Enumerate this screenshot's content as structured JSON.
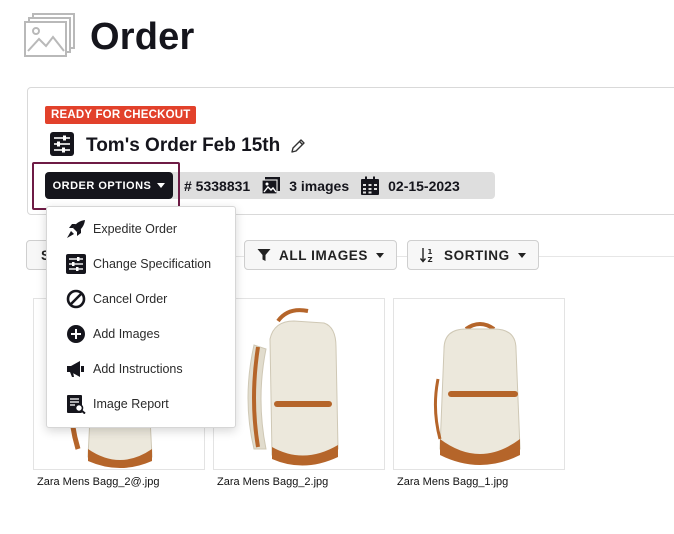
{
  "header": {
    "title": "Order",
    "icon": "image-gallery-icon"
  },
  "order": {
    "status": "READY FOR CHECKOUT",
    "status_color": "#e2412b",
    "title": "Tom's Order Feb 15th",
    "options_label": "ORDER OPTIONS",
    "number": "# 5338831",
    "image_count": "3 images",
    "date": "02-15-2023"
  },
  "toolbar": {
    "first_label": "S",
    "filter_label": "ALL IMAGES",
    "sort_label": "SORTING"
  },
  "menu": {
    "items": [
      {
        "label": "Expedite Order",
        "icon": "rocket-icon"
      },
      {
        "label": "Change Specification",
        "icon": "sliders-icon"
      },
      {
        "label": "Cancel Order",
        "icon": "cancel-icon"
      },
      {
        "label": "Add Images",
        "icon": "plus-circle-icon"
      },
      {
        "label": "Add Instructions",
        "icon": "megaphone-icon"
      },
      {
        "label": "Image Report",
        "icon": "report-icon"
      }
    ]
  },
  "products": [
    {
      "name": "Zara Mens Bagg_2@.jpg"
    },
    {
      "name": "Zara Mens Bagg_2.jpg"
    },
    {
      "name": "Zara Mens Bagg_1.jpg"
    }
  ],
  "colors": {
    "accent_dark": "#15151c",
    "highlight_border": "#6e1b45",
    "bag_canvas": "#ece8dc",
    "bag_leather": "#b5652a"
  }
}
